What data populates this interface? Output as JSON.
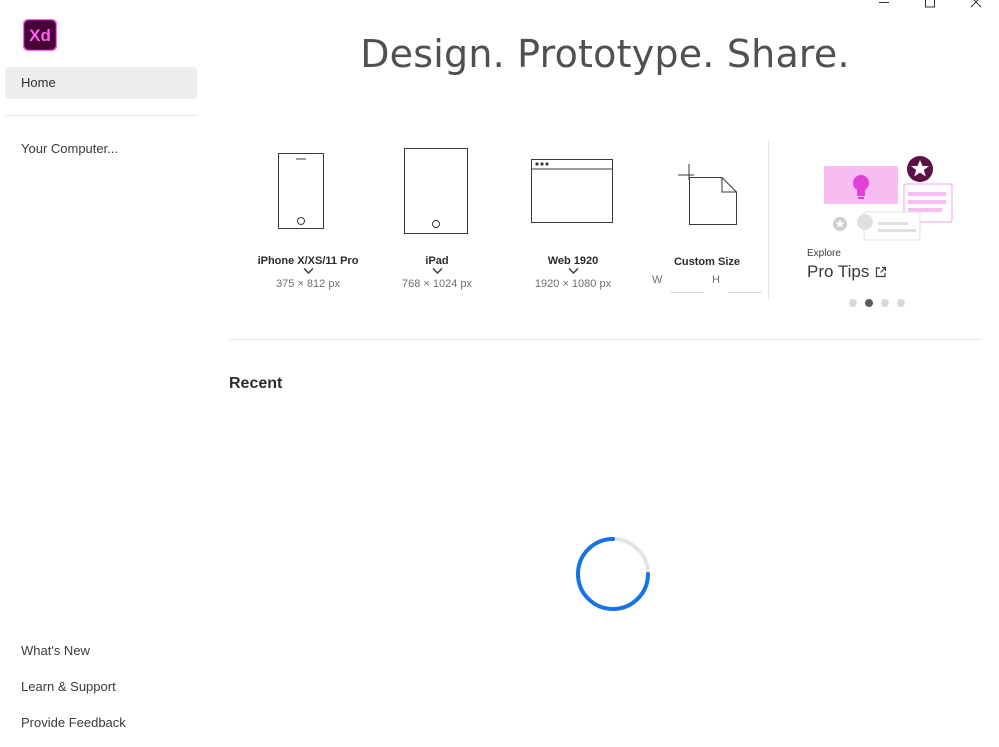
{
  "window": {
    "controls": [
      "minimize",
      "maximize",
      "close"
    ]
  },
  "app": {
    "logo_text": "Xd",
    "brand_color": "#ff61f6",
    "logo_bg": "#470137"
  },
  "sidebar": {
    "home_label": "Home",
    "your_computer_label": "Your Computer...",
    "whats_new_label": "What's New",
    "learn_support_label": "Learn & Support",
    "provide_feedback_label": "Provide Feedback"
  },
  "main": {
    "headline": "Design. Prototype. Share.",
    "presets": [
      {
        "name": "iPhone X/XS/11 Pro",
        "dims": "375 × 812 px",
        "icon": "phone-icon"
      },
      {
        "name": "iPad",
        "dims": "768 × 1024 px",
        "icon": "tablet-icon"
      },
      {
        "name": "Web 1920",
        "dims": "1920 × 1080 px",
        "icon": "browser-icon"
      },
      {
        "name": "Custom Size",
        "dims": "",
        "icon": "custom-artboard-icon"
      }
    ],
    "custom": {
      "w_label": "W",
      "h_label": "H",
      "w_value": "",
      "h_value": ""
    },
    "tips": {
      "explore_label": "Explore",
      "title": "Pro Tips",
      "carousel_active_index": 1,
      "carousel_count": 4
    },
    "recent_label": "Recent",
    "spinner_color": "#1473e6"
  }
}
